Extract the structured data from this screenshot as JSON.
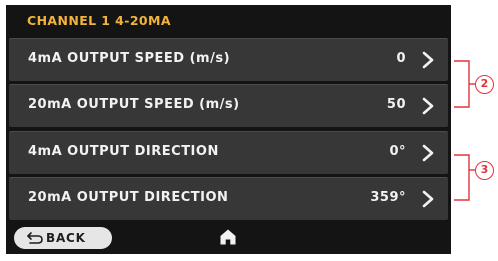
{
  "header": {
    "title": "CHANNEL 1 4-20MA"
  },
  "rows": [
    {
      "label": "4mA OUTPUT SPEED (m/s)",
      "value": "0"
    },
    {
      "label": "20mA OUTPUT SPEED (m/s)",
      "value": "50"
    },
    {
      "label": "4mA OUTPUT DIRECTION",
      "value": "0°"
    },
    {
      "label": "20mA OUTPUT DIRECTION",
      "value": "359°"
    }
  ],
  "footer": {
    "back_label": "BACK",
    "home_icon": "home-icon",
    "back_icon": "back-arrow-icon"
  },
  "callouts": [
    {
      "number": "2"
    },
    {
      "number": "3"
    }
  ],
  "colors": {
    "accent": "#f2b33d",
    "row_bg": "#373737",
    "screen_bg": "#141414",
    "callout": "#e2333a"
  }
}
